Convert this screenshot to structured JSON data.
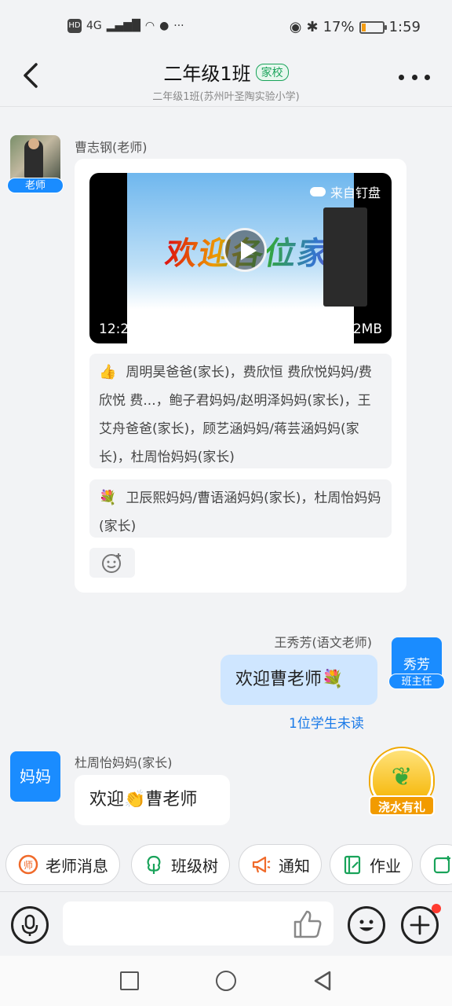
{
  "status_bar": {
    "left_icons": [
      "HD",
      "4G"
    ],
    "battery_percent": "17%",
    "time": "1:59"
  },
  "header": {
    "title": "二年级1班",
    "tag": "家校",
    "subtitle": "二年级1班(苏州叶圣陶实验小学)"
  },
  "messages": {
    "teacher": {
      "name": "曹志钢(老师)",
      "badge": "老师",
      "video": {
        "source": "来自钉盘",
        "duration": "12:22",
        "size": "78.2MB",
        "poster_text": "欢迎各位家长"
      },
      "likes": {
        "emoji": "👍",
        "text": "周明昊爸爸(家长)，费欣恒 费欣悦妈妈/费欣悦 费...，鲍子君妈妈/赵明泽妈妈(家长)，王艾舟爸爸(家长)，顾艺涵妈妈/蒋芸涵妈妈(家长)，杜周怡妈妈(家长)"
      },
      "flowers": {
        "emoji": "💐",
        "text": "卫辰熙妈妈/曹语涵妈妈(家长)，杜周怡妈妈(家长)"
      }
    },
    "self": {
      "name": "王秀芳(语文老师)",
      "avatar_text": "秀芳",
      "badge": "班主任",
      "text": "欢迎曹老师💐",
      "unread": "1位学生未读"
    },
    "parent": {
      "name": "杜周怡妈妈(家长)",
      "avatar_text": "妈妈",
      "text": "欢迎👏曹老师"
    }
  },
  "promo": {
    "label": "浇水有礼"
  },
  "quick_actions": [
    {
      "label": "老师消息",
      "icon": "teacher-icon",
      "color": "#f06a2a"
    },
    {
      "label": "班级树",
      "icon": "tree-icon",
      "color": "#19a35a"
    },
    {
      "label": "通知",
      "icon": "megaphone-icon",
      "color": "#f06a2a"
    },
    {
      "label": "作业",
      "icon": "homework-icon",
      "color": "#19a35a"
    }
  ],
  "colors": {
    "accent": "#1a8cff",
    "self_bubble": "#cfe6ff",
    "tag_green": "#19a35a",
    "background": "#f2f3f5"
  }
}
